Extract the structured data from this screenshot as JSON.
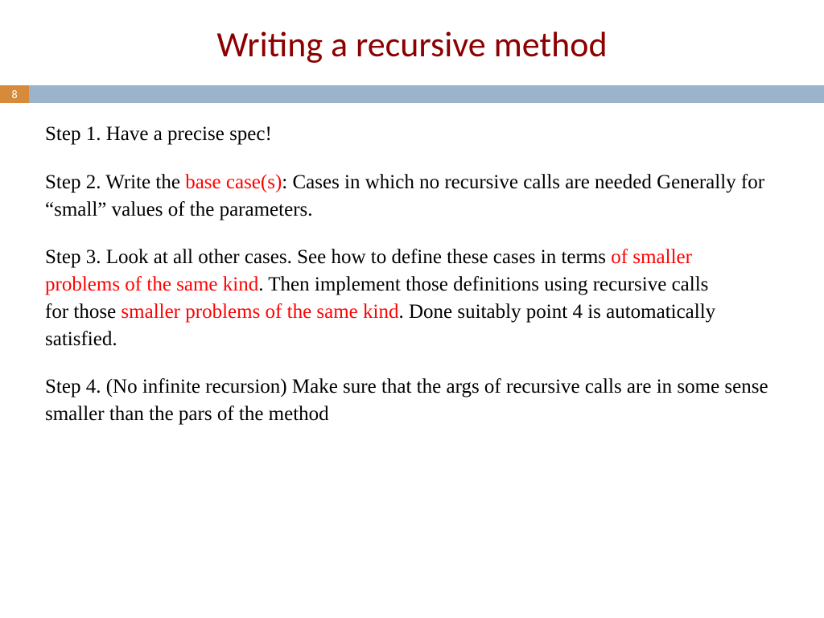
{
  "title": "Writing a recursive method",
  "pageNumber": "8",
  "step1": "Step 1. Have a precise spec!",
  "step2": {
    "pre": "Step 2. Write the ",
    "red": "base case(s)",
    "post": ": Cases in which no recursive calls are needed Generally for “small” values of the parameters."
  },
  "step3": {
    "p1": "Step 3. Look at all other cases. See how to define these cases in terms ",
    "r1": "of smaller problems of the same kind",
    "p2": ". Then implement those definitions using recursive calls for those ",
    "r2": "smaller problems of the same kind",
    "p3": ". Done suitably point 4 is automatically satisfied."
  },
  "step4": "Step 4. (No infinite recursion) Make sure that the args of recursive calls are in some sense smaller than the pars of the method"
}
